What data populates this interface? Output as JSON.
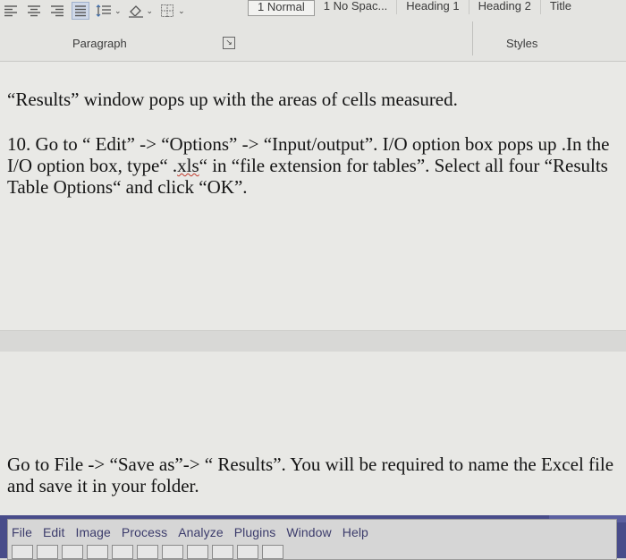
{
  "ribbon": {
    "paragraph_tools": [
      {
        "icon": "align-left-icon"
      },
      {
        "icon": "align-center-icon"
      },
      {
        "icon": "align-right-icon"
      },
      {
        "icon": "justify-icon",
        "selected": true
      },
      {
        "icon": "line-spacing-icon"
      },
      {
        "icon": "shading-icon"
      },
      {
        "icon": "borders-icon"
      }
    ],
    "styles": [
      "1 Normal",
      "1 No Spac...",
      "Heading 1",
      "Heading 2",
      "Title"
    ],
    "active_style_index": 0,
    "paragraph_label": "Paragraph",
    "styles_label": "Styles"
  },
  "document": {
    "para1": "“Results” window pops up with the areas of cells measured.",
    "para2_before": "10. Go to “ Edit” -> “Options” -> “Input/output”. I/O option box pops up .In the I/O option box, type“ .",
    "para2_spell": "xls",
    "para2_after": "“ in “file extension for tables”. Select all four “Results Table Options“ and click “OK”.",
    "para3": "Go to File -> “Save as”-> “ Results”. You will be required to name the Excel file and save it in your folder."
  },
  "imagej": {
    "menu": [
      "File",
      "Edit",
      "Image",
      "Process",
      "Analyze",
      "Plugins",
      "Window",
      "Help"
    ]
  },
  "colors": {
    "ribbon_bg": "#e4e4e1",
    "page_bg": "#e9e9e6",
    "imagej_frame": "#484c8a"
  }
}
